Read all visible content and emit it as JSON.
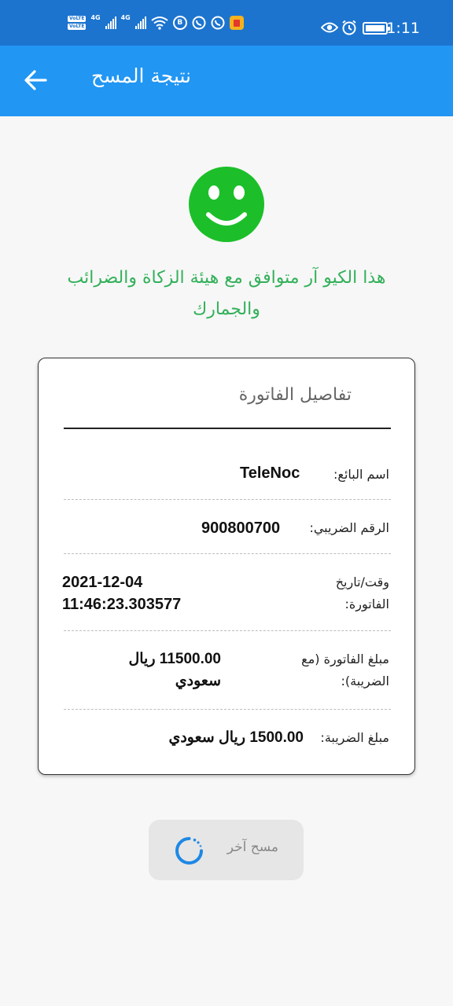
{
  "status_bar": {
    "time": "1:11",
    "volte_1": "VoLTE",
    "volte_2": "VoLTE",
    "net_1": "4G",
    "net_2": "4G",
    "app_icon_b": "B",
    "icons": [
      "signal-icon",
      "wifi-icon",
      "whatsapp-icon",
      "eye-icon",
      "alarm-icon",
      "battery-icon"
    ]
  },
  "app_bar": {
    "title": "نتيجة المسح",
    "back_icon": "arrow-left-icon",
    "color": "#2196f3"
  },
  "result": {
    "icon": "smiley-icon",
    "icon_color": "#1cbf2a",
    "message": "هذا الكيو آر متوافق مع هيئة الزكاة والضرائب والجمارك",
    "message_color": "#33b05a"
  },
  "invoice": {
    "title": "تفاصيل الفاتورة",
    "rows": [
      {
        "label": "اسم البائع:",
        "value": "TeleNoc"
      },
      {
        "label": "الرقم الضريبي:",
        "value": "900800700"
      },
      {
        "label": "وقت/تاريخ الفاتورة:",
        "value": "2021-12-04 11:46:23.303577"
      },
      {
        "label": "مبلغ الفاتورة (مع الضريبة):",
        "value": "11500.00 ريال سعودي"
      },
      {
        "label": "مبلغ الضريبة:",
        "value": "1500.00 ريال سعودي"
      }
    ]
  },
  "scan_again": {
    "label": "مسح آخر"
  }
}
